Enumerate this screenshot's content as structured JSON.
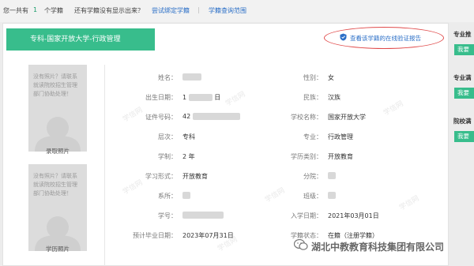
{
  "topbar": {
    "total_prefix": "您一共有",
    "total_count": "1",
    "total_suffix": "个学籍",
    "question": "还有学籍没有显示出来？",
    "bind_link": "尝试绑定学籍",
    "separator": "|",
    "scope_link": "学籍查询范围"
  },
  "banner": {
    "title": "专科-国家开放大学-行政管理"
  },
  "verify": {
    "label": "查看该学籍的在线验证报告",
    "icon": "shield-check-icon"
  },
  "photos": {
    "note": "没有照片？请联系就读院校招生管理部门协助处理！",
    "admission_caption": "录取照片",
    "degree_caption": "学历照片"
  },
  "fields": {
    "name_label": "姓名：",
    "gender_label": "性别：",
    "gender_value": "女",
    "birth_label": "出生日期：",
    "birth_value_prefix": "1",
    "birth_value_suffix": "日",
    "ethnicity_label": "民族：",
    "ethnicity_value": "汉族",
    "id_label": "证件号码：",
    "id_value_prefix": "42",
    "school_label": "学校名称：",
    "school_value": "国家开放大学",
    "level_label": "层次：",
    "level_value": "专科",
    "major_label": "专业：",
    "major_value": "行政管理",
    "length_label": "学制：",
    "length_value": "2 年",
    "category_label": "学历类别：",
    "category_value": "开放教育",
    "form_label": "学习形式：",
    "form_value": "开放教育",
    "branch_label": "分院：",
    "dept_label": "系所：",
    "class_label": "班级：",
    "student_no_label": "学号：",
    "enroll_label": "入学日期：",
    "enroll_value": "2021年03月01日",
    "grad_label": "预计毕业日期：",
    "grad_value": "2023年07月31日",
    "status_label": "学籍状态：",
    "status_value": "在籍（注册学籍）"
  },
  "watermark": {
    "text": "学信网"
  },
  "right_panel": {
    "sections": [
      "专业推",
      "专业满",
      "院校满"
    ],
    "button_label": "我要"
  },
  "footer": {
    "wechat_text": "湖北中教教育科技集团有限公司",
    "icon": "wechat-icon"
  }
}
